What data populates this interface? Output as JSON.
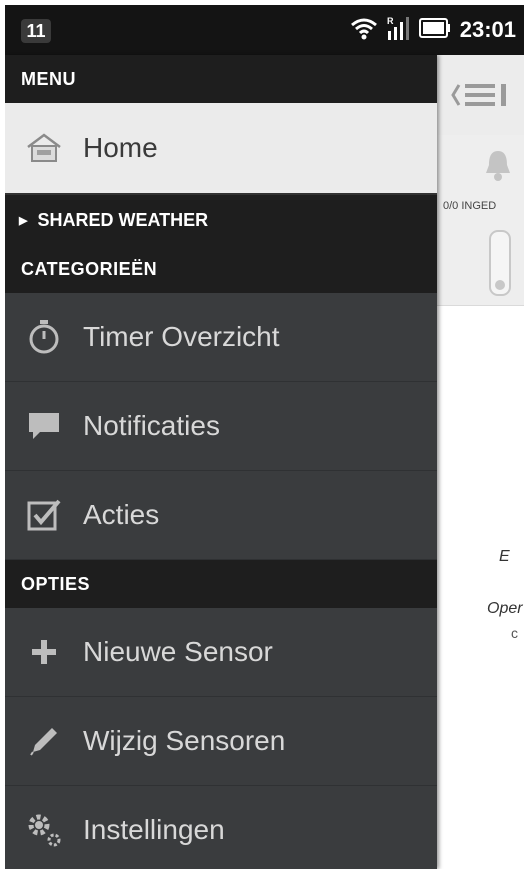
{
  "status_bar": {
    "notification_count": "11",
    "time": "23:01",
    "icons": [
      "wifi-icon",
      "signal-icon",
      "battery-icon"
    ]
  },
  "drawer": {
    "menu_header": "MENU",
    "home_label": "Home",
    "shared_weather_label": "SHARED WEATHER",
    "categories_header": "CATEGORIEËN",
    "categories": [
      {
        "label": "Timer Overzicht",
        "icon": "stopwatch-icon"
      },
      {
        "label": "Notificaties",
        "icon": "speech-bubble-icon"
      },
      {
        "label": "Acties",
        "icon": "checkbox-icon"
      }
    ],
    "options_header": "OPTIES",
    "options": [
      {
        "label": "Nieuwe Sensor",
        "icon": "plus-icon"
      },
      {
        "label": "Wijzig Sensoren",
        "icon": "pencil-icon"
      },
      {
        "label": "Instellingen",
        "icon": "gear-icon"
      }
    ]
  },
  "background_content": {
    "partial_label": "0/0 INGED",
    "text1": "E",
    "text2": "Oper",
    "text3": "c"
  },
  "colors": {
    "drawer_bg": "#3a3c3e",
    "header_bg": "#1e1e1e",
    "home_selected_bg": "#ebebeb"
  }
}
